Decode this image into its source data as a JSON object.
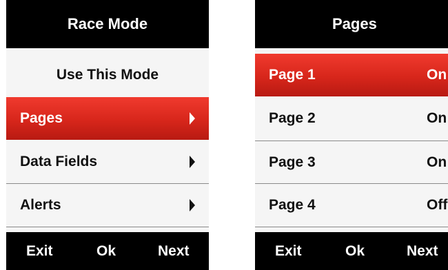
{
  "left_screen": {
    "title": "Race Mode",
    "use_mode_label": "Use This Mode",
    "menu": [
      {
        "label": "Pages",
        "selected": true
      },
      {
        "label": "Data Fields",
        "selected": false
      },
      {
        "label": "Alerts",
        "selected": false
      }
    ],
    "footer": {
      "exit": "Exit",
      "ok": "Ok",
      "next": "Next"
    }
  },
  "right_screen": {
    "title": "Pages",
    "pages": [
      {
        "label": "Page 1",
        "status": "On",
        "selected": true
      },
      {
        "label": "Page 2",
        "status": "On",
        "selected": false
      },
      {
        "label": "Page 3",
        "status": "On",
        "selected": false
      },
      {
        "label": "Page 4",
        "status": "Off",
        "selected": false
      }
    ],
    "footer": {
      "exit": "Exit",
      "ok": "Ok",
      "next": "Next"
    }
  },
  "colors": {
    "header": "#000000",
    "selection": "#d7261b",
    "background": "#f5f5f5"
  },
  "icons": {
    "menu_arrow": "triangle-right-icon"
  }
}
